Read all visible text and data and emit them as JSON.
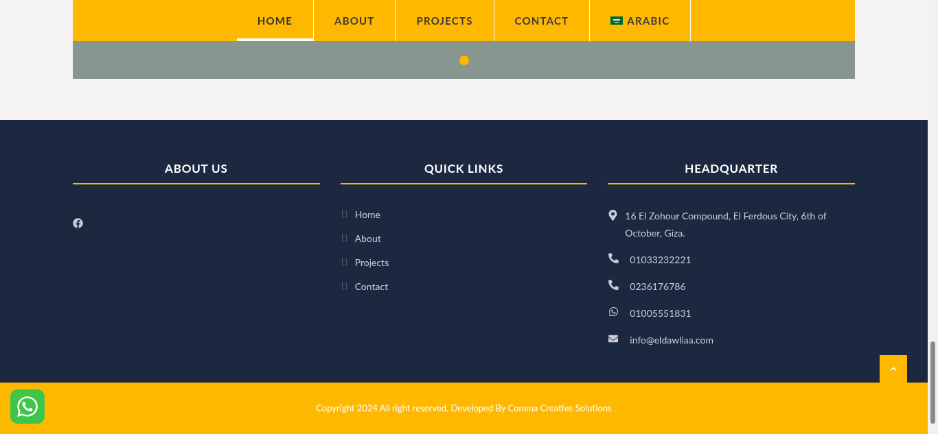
{
  "nav": {
    "items": [
      {
        "label": "HOME",
        "selected": true,
        "kind": "link"
      },
      {
        "label": "ABOUT",
        "selected": false,
        "kind": "link"
      },
      {
        "label": "PROJECTS",
        "selected": false,
        "kind": "link"
      },
      {
        "label": "CONTACT",
        "selected": false,
        "kind": "link"
      },
      {
        "label": "ARABIC",
        "selected": false,
        "kind": "language"
      }
    ]
  },
  "footer": {
    "about": {
      "title": "ABOUT US"
    },
    "quick_links": {
      "title": "QUICK LINKS",
      "items": [
        "Home",
        "About",
        "Projects",
        "Contact"
      ]
    },
    "headquarter": {
      "title": "HEADQUARTER",
      "items": [
        {
          "kind": "address",
          "text": "16 El Zohour Compound, El Ferdous City, 6th of October, Giza."
        },
        {
          "kind": "phone",
          "text": "01033232221"
        },
        {
          "kind": "phone",
          "text": "0236176786"
        },
        {
          "kind": "whatsapp",
          "text": "01005551831"
        },
        {
          "kind": "email",
          "text": "info@eldawliaa.com"
        }
      ]
    }
  },
  "copyright": "Copyright 2024 All right reserved. Developed By Comma Creative Solutions"
}
